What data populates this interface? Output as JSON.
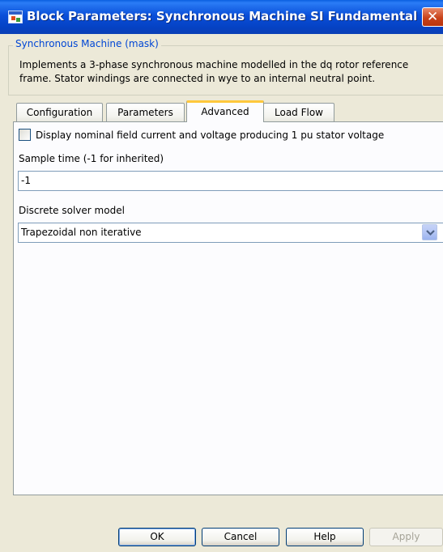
{
  "window": {
    "title": "Block Parameters: Synchronous Machine SI Fundamental",
    "close_symbol": "✕"
  },
  "group": {
    "legend": "Synchronous Machine (mask)",
    "description_line1": "Implements a 3-phase synchronous machine modelled in the dq rotor reference",
    "description_line2": "frame. Stator windings are connected in wye to an internal neutral point."
  },
  "tabs": [
    {
      "label": "Configuration",
      "active": false
    },
    {
      "label": "Parameters",
      "active": false
    },
    {
      "label": "Advanced",
      "active": true
    },
    {
      "label": "Load Flow",
      "active": false
    }
  ],
  "advanced": {
    "checkbox_label": "Display nominal field current and voltage producing 1 pu stator voltage",
    "checkbox_checked": false,
    "sample_time_label": "Sample time (-1 for inherited)",
    "sample_time_value": "-1",
    "solver_label": "Discrete solver model",
    "solver_value": "Trapezoidal non iterative"
  },
  "buttons": {
    "ok": "OK",
    "cancel": "Cancel",
    "help": "Help",
    "apply": "Apply"
  },
  "colors": {
    "titlebar": "#0a4fd9",
    "legend_text": "#0046d5",
    "active_tab_highlight": "#ffc83c",
    "close_button": "#c8421a"
  }
}
